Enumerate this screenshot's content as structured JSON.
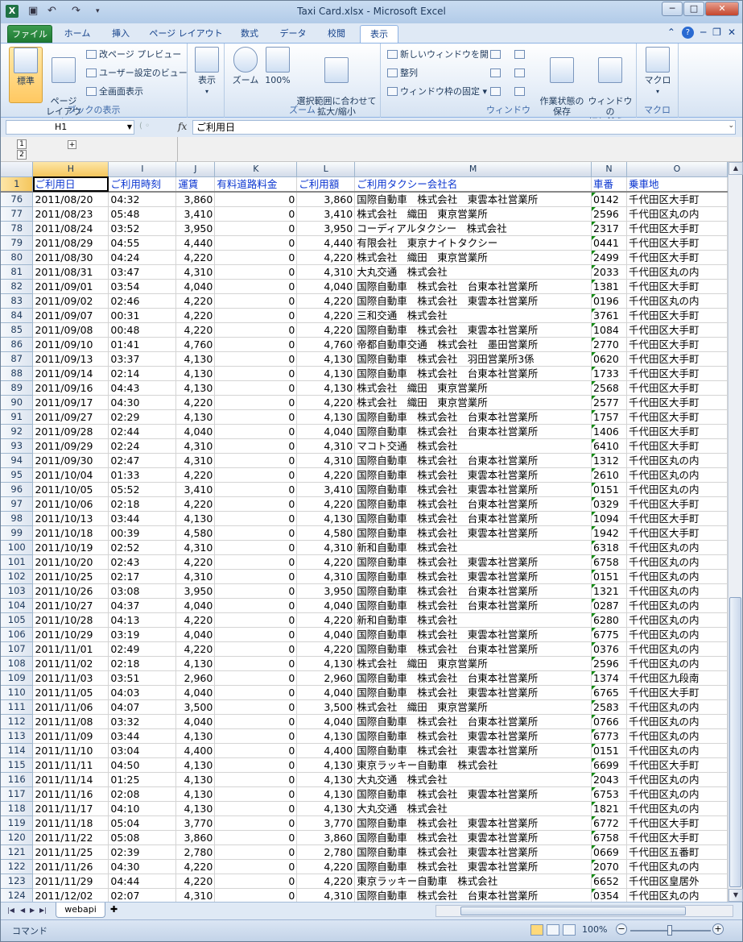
{
  "window": {
    "title": "Taxi Card.xlsx - Microsoft Excel",
    "app_icon": "X"
  },
  "ribbon": {
    "tabs": [
      "ファイル",
      "ホーム",
      "挿入",
      "ページ レイアウト",
      "数式",
      "データ",
      "校閲",
      "表示"
    ],
    "active_tab": "表示",
    "groups": {
      "workbook_views": {
        "label": "ブックの表示",
        "normal": "標準",
        "page_layout": "ページ\nレイアウト",
        "page_break": "改ページ プレビュー",
        "custom_views": "ユーザー設定のビュー",
        "full_screen": "全画面表示"
      },
      "show": {
        "label": "表示"
      },
      "zoom": {
        "label": "ズーム",
        "zoom": "ズーム",
        "hundred": "100%",
        "fit_selection": "選択範囲に合わせて\n拡大/縮小"
      },
      "window": {
        "label": "ウィンドウ",
        "new_window": "新しいウィンドウを開く",
        "arrange": "整列",
        "freeze": "ウィンドウ枠の固定",
        "save_workspace": "作業状態の\n保存",
        "switch": "ウィンドウの\n切り替え"
      },
      "macros": {
        "label": "マクロ",
        "macro": "マクロ"
      }
    }
  },
  "formula_bar": {
    "name_box": "H1",
    "fx": "fx",
    "content": "ご利用日"
  },
  "outline": {
    "levels": [
      "1",
      "2"
    ],
    "expand": "+"
  },
  "columns": [
    "H",
    "I",
    "J",
    "K",
    "L",
    "M",
    "N",
    "O"
  ],
  "header_row": {
    "row": "1",
    "cells": [
      "ご利用日",
      "ご利用時刻",
      "運賃",
      "有料道路料金",
      "ご利用額",
      "ご利用タクシー会社名",
      "車番",
      "乗車地"
    ]
  },
  "rows": [
    [
      "76",
      "2011/08/20",
      "04:32",
      "3,860",
      "0",
      "3,860",
      "国際自動車　株式会社　東雲本社営業所",
      "0142",
      "千代田区大手町"
    ],
    [
      "77",
      "2011/08/23",
      "05:48",
      "3,410",
      "0",
      "3,410",
      "株式会社　織田　東京営業所",
      "2596",
      "千代田区丸の内"
    ],
    [
      "78",
      "2011/08/24",
      "03:52",
      "3,950",
      "0",
      "3,950",
      "コーディアルタクシー　株式会社",
      "2317",
      "千代田区大手町"
    ],
    [
      "79",
      "2011/08/29",
      "04:55",
      "4,440",
      "0",
      "4,440",
      "有限会社　東京ナイトタクシー",
      "0441",
      "千代田区大手町"
    ],
    [
      "80",
      "2011/08/30",
      "04:24",
      "4,220",
      "0",
      "4,220",
      "株式会社　織田　東京営業所",
      "2499",
      "千代田区大手町"
    ],
    [
      "81",
      "2011/08/31",
      "03:47",
      "4,310",
      "0",
      "4,310",
      "大丸交通　株式会社",
      "2033",
      "千代田区丸の内"
    ],
    [
      "82",
      "2011/09/01",
      "03:54",
      "4,040",
      "0",
      "4,040",
      "国際自動車　株式会社　台東本社営業所",
      "1381",
      "千代田区大手町"
    ],
    [
      "83",
      "2011/09/02",
      "02:46",
      "4,220",
      "0",
      "4,220",
      "国際自動車　株式会社　東雲本社営業所",
      "0196",
      "千代田区丸の内"
    ],
    [
      "84",
      "2011/09/07",
      "00:31",
      "4,220",
      "0",
      "4,220",
      "三和交通　株式会社",
      "3761",
      "千代田区大手町"
    ],
    [
      "85",
      "2011/09/08",
      "00:48",
      "4,220",
      "0",
      "4,220",
      "国際自動車　株式会社　東雲本社営業所",
      "1084",
      "千代田区大手町"
    ],
    [
      "86",
      "2011/09/10",
      "01:41",
      "4,760",
      "0",
      "4,760",
      "帝都自動車交通　株式会社　墨田営業所",
      "2770",
      "千代田区大手町"
    ],
    [
      "87",
      "2011/09/13",
      "03:37",
      "4,130",
      "0",
      "4,130",
      "国際自動車　株式会社　羽田営業所3係",
      "0620",
      "千代田区大手町"
    ],
    [
      "88",
      "2011/09/14",
      "02:14",
      "4,130",
      "0",
      "4,130",
      "国際自動車　株式会社　台東本社営業所",
      "1733",
      "千代田区大手町"
    ],
    [
      "89",
      "2011/09/16",
      "04:43",
      "4,130",
      "0",
      "4,130",
      "株式会社　織田　東京営業所",
      "2568",
      "千代田区大手町"
    ],
    [
      "90",
      "2011/09/17",
      "04:30",
      "4,220",
      "0",
      "4,220",
      "株式会社　織田　東京営業所",
      "2577",
      "千代田区大手町"
    ],
    [
      "91",
      "2011/09/27",
      "02:29",
      "4,130",
      "0",
      "4,130",
      "国際自動車　株式会社　台東本社営業所",
      "1757",
      "千代田区大手町"
    ],
    [
      "92",
      "2011/09/28",
      "02:44",
      "4,040",
      "0",
      "4,040",
      "国際自動車　株式会社　台東本社営業所",
      "1406",
      "千代田区大手町"
    ],
    [
      "93",
      "2011/09/29",
      "02:24",
      "4,310",
      "0",
      "4,310",
      "マコト交通　株式会社",
      "6410",
      "千代田区大手町"
    ],
    [
      "94",
      "2011/09/30",
      "02:47",
      "4,310",
      "0",
      "4,310",
      "国際自動車　株式会社　台東本社営業所",
      "1312",
      "千代田区丸の内"
    ],
    [
      "95",
      "2011/10/04",
      "01:33",
      "4,220",
      "0",
      "4,220",
      "国際自動車　株式会社　東雲本社営業所",
      "2610",
      "千代田区丸の内"
    ],
    [
      "96",
      "2011/10/05",
      "05:52",
      "3,410",
      "0",
      "3,410",
      "国際自動車　株式会社　東雲本社営業所",
      "0151",
      "千代田区丸の内"
    ],
    [
      "97",
      "2011/10/06",
      "02:18",
      "4,220",
      "0",
      "4,220",
      "国際自動車　株式会社　台東本社営業所",
      "0329",
      "千代田区大手町"
    ],
    [
      "98",
      "2011/10/13",
      "03:44",
      "4,130",
      "0",
      "4,130",
      "国際自動車　株式会社　台東本社営業所",
      "1094",
      "千代田区大手町"
    ],
    [
      "99",
      "2011/10/18",
      "00:39",
      "4,580",
      "0",
      "4,580",
      "国際自動車　株式会社　東雲本社営業所",
      "1942",
      "千代田区大手町"
    ],
    [
      "100",
      "2011/10/19",
      "02:52",
      "4,310",
      "0",
      "4,310",
      "新和自動車　株式会社",
      "6318",
      "千代田区丸の内"
    ],
    [
      "101",
      "2011/10/20",
      "02:43",
      "4,220",
      "0",
      "4,220",
      "国際自動車　株式会社　東雲本社営業所",
      "6758",
      "千代田区丸の内"
    ],
    [
      "102",
      "2011/10/25",
      "02:17",
      "4,310",
      "0",
      "4,310",
      "国際自動車　株式会社　東雲本社営業所",
      "0151",
      "千代田区丸の内"
    ],
    [
      "103",
      "2011/10/26",
      "03:08",
      "3,950",
      "0",
      "3,950",
      "国際自動車　株式会社　台東本社営業所",
      "1321",
      "千代田区丸の内"
    ],
    [
      "104",
      "2011/10/27",
      "04:37",
      "4,040",
      "0",
      "4,040",
      "国際自動車　株式会社　台東本社営業所",
      "0287",
      "千代田区丸の内"
    ],
    [
      "105",
      "2011/10/28",
      "04:13",
      "4,220",
      "0",
      "4,220",
      "新和自動車　株式会社",
      "6280",
      "千代田区丸の内"
    ],
    [
      "106",
      "2011/10/29",
      "03:19",
      "4,040",
      "0",
      "4,040",
      "国際自動車　株式会社　東雲本社営業所",
      "6775",
      "千代田区丸の内"
    ],
    [
      "107",
      "2011/11/01",
      "02:49",
      "4,220",
      "0",
      "4,220",
      "国際自動車　株式会社　台東本社営業所",
      "0376",
      "千代田区丸の内"
    ],
    [
      "108",
      "2011/11/02",
      "02:18",
      "4,130",
      "0",
      "4,130",
      "株式会社　織田　東京営業所",
      "2596",
      "千代田区丸の内"
    ],
    [
      "109",
      "2011/11/03",
      "03:51",
      "2,960",
      "0",
      "2,960",
      "国際自動車　株式会社　台東本社営業所",
      "1374",
      "千代田区九段南"
    ],
    [
      "110",
      "2011/11/05",
      "04:03",
      "4,040",
      "0",
      "4,040",
      "国際自動車　株式会社　東雲本社営業所",
      "6765",
      "千代田区大手町"
    ],
    [
      "111",
      "2011/11/06",
      "04:07",
      "3,500",
      "0",
      "3,500",
      "株式会社　織田　東京営業所",
      "2583",
      "千代田区丸の内"
    ],
    [
      "112",
      "2011/11/08",
      "03:32",
      "4,040",
      "0",
      "4,040",
      "国際自動車　株式会社　台東本社営業所",
      "0766",
      "千代田区丸の内"
    ],
    [
      "113",
      "2011/11/09",
      "03:44",
      "4,130",
      "0",
      "4,130",
      "国際自動車　株式会社　東雲本社営業所",
      "6773",
      "千代田区丸の内"
    ],
    [
      "114",
      "2011/11/10",
      "03:04",
      "4,400",
      "0",
      "4,400",
      "国際自動車　株式会社　東雲本社営業所",
      "0151",
      "千代田区丸の内"
    ],
    [
      "115",
      "2011/11/11",
      "04:50",
      "4,130",
      "0",
      "4,130",
      "東京ラッキー自動車　株式会社",
      "6699",
      "千代田区大手町"
    ],
    [
      "116",
      "2011/11/14",
      "01:25",
      "4,130",
      "0",
      "4,130",
      "大丸交通　株式会社",
      "2043",
      "千代田区丸の内"
    ],
    [
      "117",
      "2011/11/16",
      "02:08",
      "4,130",
      "0",
      "4,130",
      "国際自動車　株式会社　東雲本社営業所",
      "6753",
      "千代田区丸の内"
    ],
    [
      "118",
      "2011/11/17",
      "04:10",
      "4,130",
      "0",
      "4,130",
      "大丸交通　株式会社",
      "1821",
      "千代田区丸の内"
    ],
    [
      "119",
      "2011/11/18",
      "05:04",
      "3,770",
      "0",
      "3,770",
      "国際自動車　株式会社　東雲本社営業所",
      "6772",
      "千代田区大手町"
    ],
    [
      "120",
      "2011/11/22",
      "05:08",
      "3,860",
      "0",
      "3,860",
      "国際自動車　株式会社　東雲本社営業所",
      "6758",
      "千代田区大手町"
    ],
    [
      "121",
      "2011/11/25",
      "02:39",
      "2,780",
      "0",
      "2,780",
      "国際自動車　株式会社　東雲本社営業所",
      "0669",
      "千代田区五番町"
    ],
    [
      "122",
      "2011/11/26",
      "04:30",
      "4,220",
      "0",
      "4,220",
      "国際自動車　株式会社　東雲本社営業所",
      "2070",
      "千代田区丸の内"
    ],
    [
      "123",
      "2011/11/29",
      "04:44",
      "4,220",
      "0",
      "4,220",
      "東京ラッキー自動車　株式会社",
      "6652",
      "千代田区皇居外"
    ],
    [
      "124",
      "2011/12/02",
      "02:07",
      "4,310",
      "0",
      "4,310",
      "国際自動車　株式会社　台東本社営業所",
      "0354",
      "千代田区丸の内"
    ]
  ],
  "sheet_tabs": {
    "active": "webapi"
  },
  "status": {
    "mode": "コマンド",
    "zoom": "100%"
  },
  "icons": {
    "app": "excel-icon",
    "save": "save-icon",
    "undo": "undo-icon",
    "redo": "redo-icon",
    "help": "help-icon"
  }
}
